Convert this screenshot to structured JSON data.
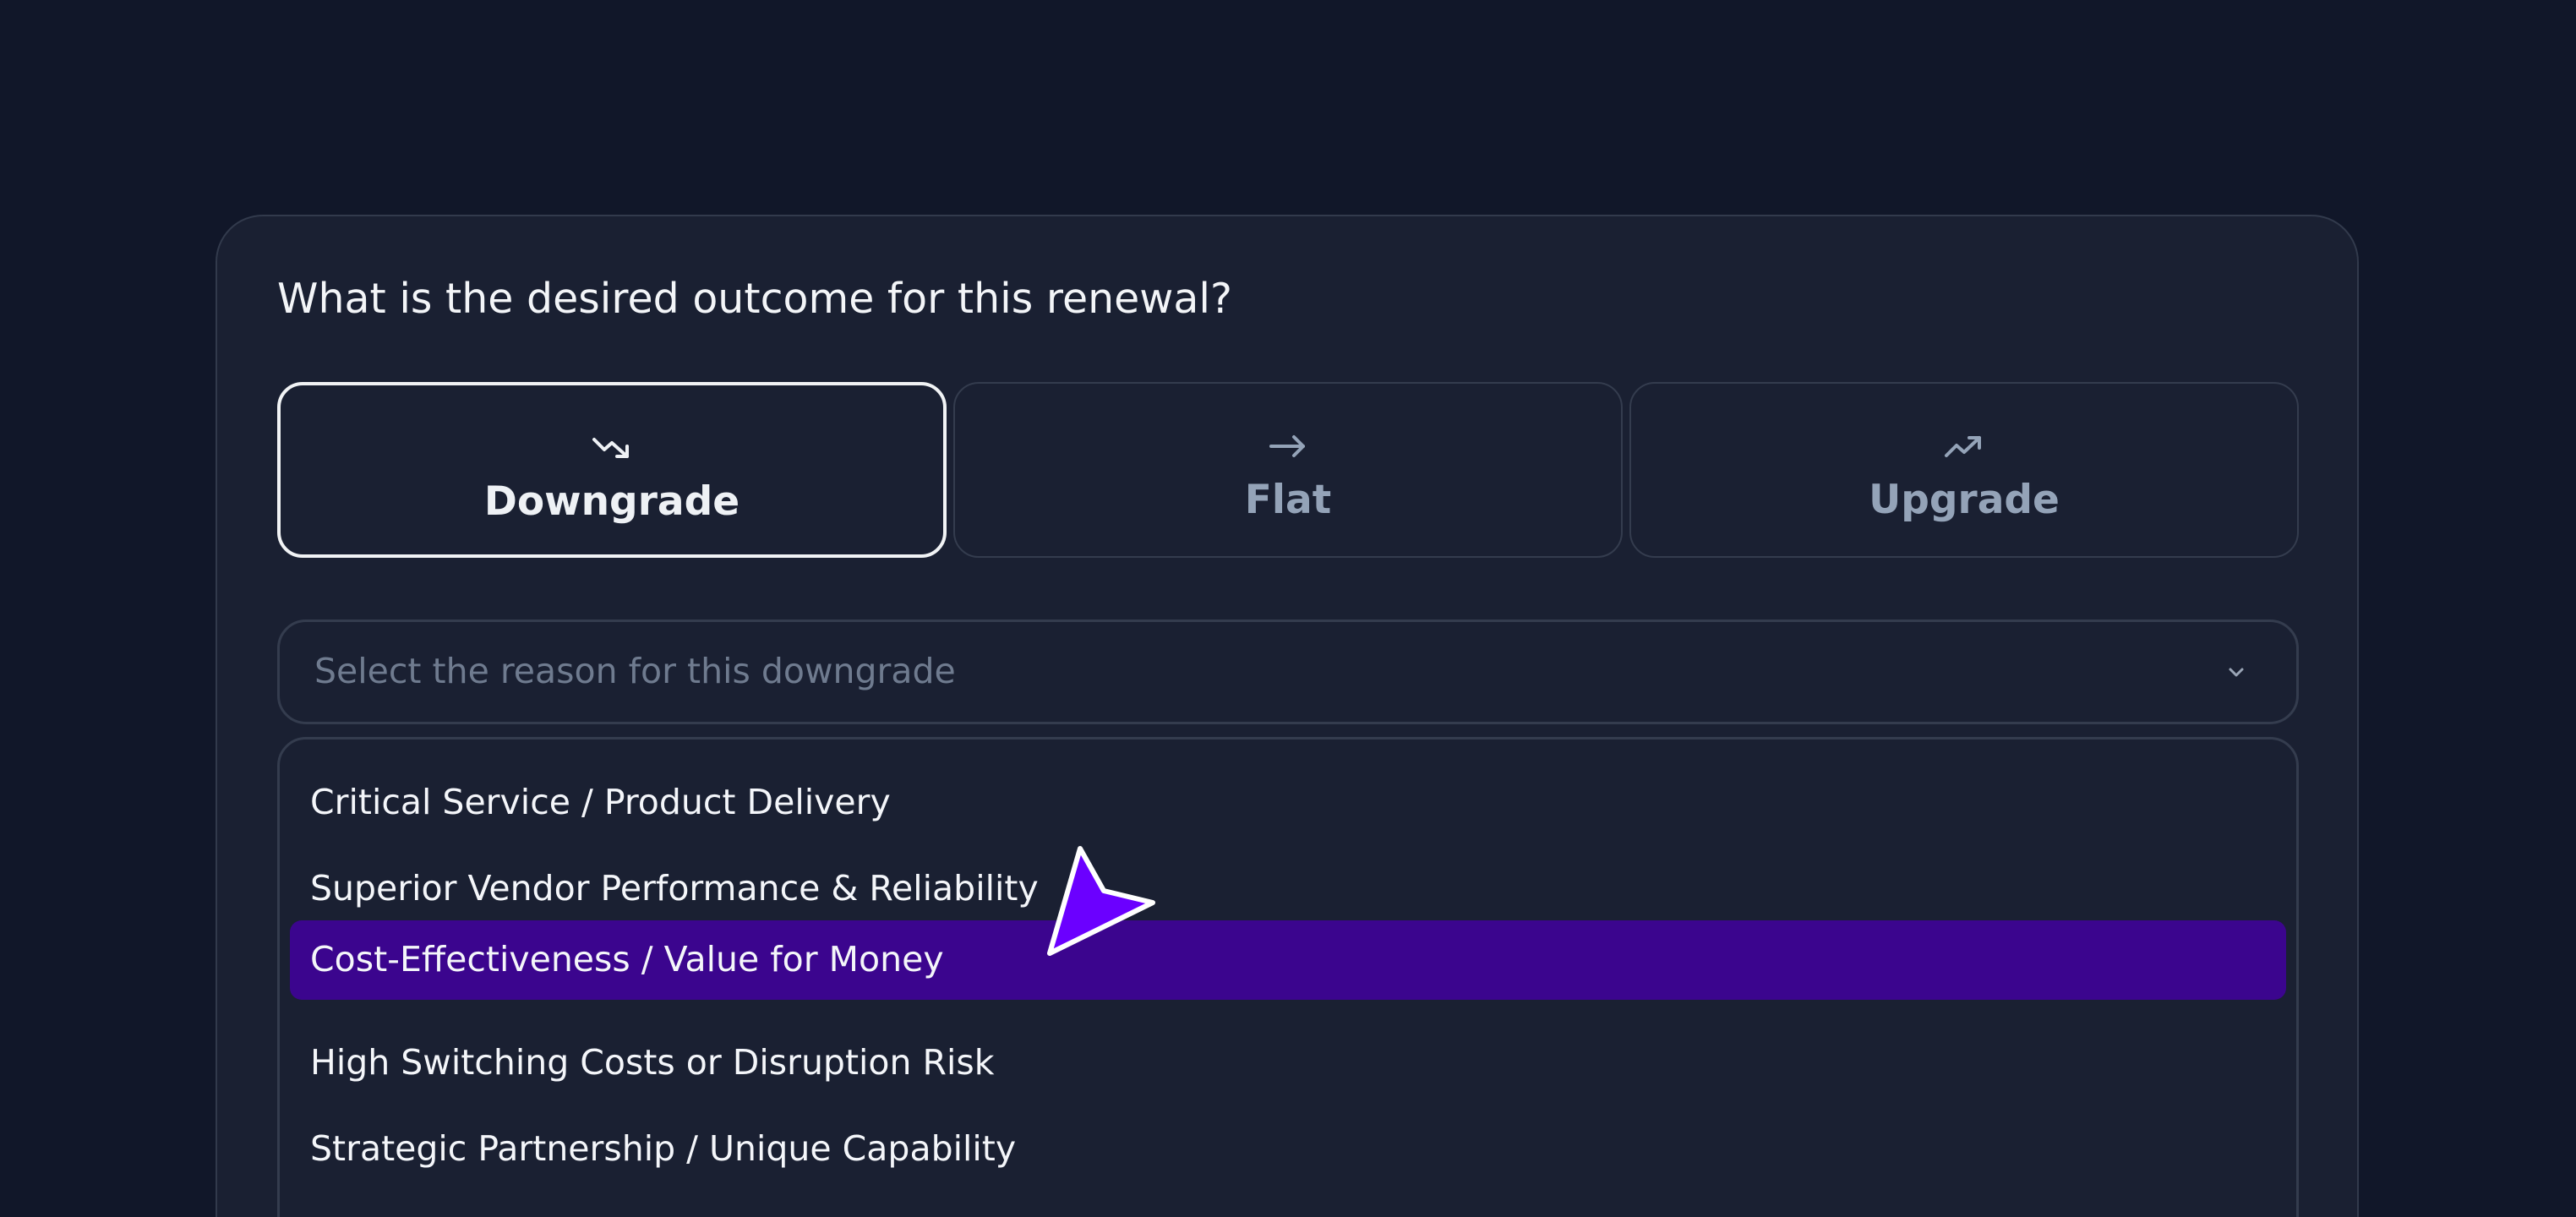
{
  "question": "What is the desired outcome for this renewal?",
  "outcome_options": [
    {
      "label": "Downgrade",
      "icon": "trending-down-icon",
      "selected": true
    },
    {
      "label": "Flat",
      "icon": "arrow-right-icon",
      "selected": false
    },
    {
      "label": "Upgrade",
      "icon": "trending-up-icon",
      "selected": false
    }
  ],
  "reason_select": {
    "placeholder": "Select the reason for this downgrade",
    "icon": "chevron-down-icon"
  },
  "reason_options": [
    {
      "label": "Critical Service / Product Delivery",
      "highlighted": false
    },
    {
      "label": "Superior Vendor Performance & Reliability",
      "highlighted": false
    },
    {
      "label": "Cost-Effectiveness / Value for Money",
      "highlighted": true
    },
    {
      "label": "High Switching Costs or Disruption Risk",
      "highlighted": false
    },
    {
      "label": "Strategic Partnership / Unique Capability",
      "highlighted": false
    }
  ],
  "cursor": {
    "icon": "mouse-pointer-icon"
  },
  "colors": {
    "background": "#111729",
    "card": "#1a2032",
    "border": "#343c4e",
    "selected_border": "#f1f3f5",
    "muted_text": "#94a3b8",
    "placeholder_text": "#6f7b8f",
    "highlight": "#3b058e",
    "cursor": "#6b00ff"
  }
}
